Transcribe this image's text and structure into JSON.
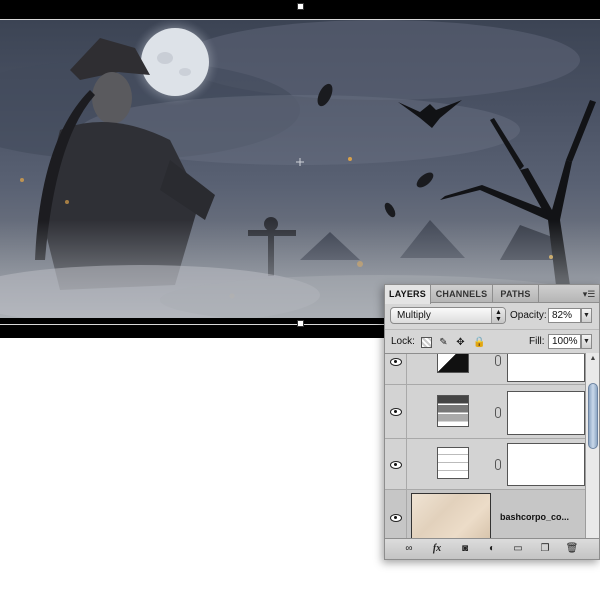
{
  "layers_panel": {
    "tabs": [
      {
        "label": "LAYERS",
        "active": true
      },
      {
        "label": "CHANNELS",
        "active": false
      },
      {
        "label": "PATHS",
        "active": false
      }
    ],
    "menu_icon": "panel-menu-icon",
    "blend_mode": "Multiply",
    "opacity_label": "Opacity:",
    "opacity_value": "82%",
    "lock_label": "Lock:",
    "fill_label": "Fill:",
    "fill_value": "100%",
    "lock_icons": [
      "lock-transparent-pixels-icon",
      "lock-image-pixels-icon",
      "lock-position-icon",
      "lock-all-icon"
    ],
    "layers": [
      {
        "type": "levels-adjustment",
        "icon": "levels-icon",
        "mask": "white",
        "visible": true
      },
      {
        "type": "gradient-map-adjustment",
        "icon": "gradient-map-icon",
        "mask": "white",
        "visible": true
      },
      {
        "type": "curves-adjustment",
        "icon": "curves-icon",
        "mask": "white",
        "visible": true
      },
      {
        "type": "texture",
        "name": "bashcorpo_co...",
        "visible": true,
        "selected": true
      }
    ],
    "bottom_tools": [
      "link-layers-icon",
      "fx-icon",
      "add-mask-icon",
      "adjustment-layer-icon",
      "new-group-icon",
      "new-layer-icon",
      "trash-icon"
    ]
  },
  "colors": {
    "sky": "#4a5264",
    "fog": "#8a8e96",
    "moon": "#e8ecf0",
    "panel_bg": "#d6d6d6",
    "scroll_thumb": "#a9bcd4"
  }
}
